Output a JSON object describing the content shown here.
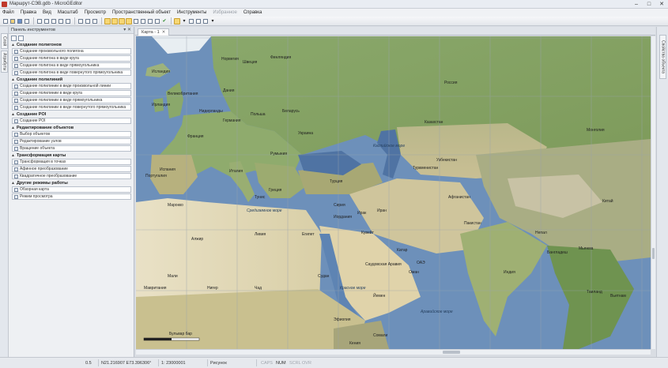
{
  "window": {
    "title": "Маршрут-СЭВ.gdb - MicroGEditor",
    "minimize": "–",
    "maximize": "□",
    "close": "✕"
  },
  "menu": {
    "items": [
      {
        "label": "Файл",
        "enabled": true
      },
      {
        "label": "Правка",
        "enabled": true
      },
      {
        "label": "Вид",
        "enabled": true
      },
      {
        "label": "Масштаб",
        "enabled": true
      },
      {
        "label": "Просмотр",
        "enabled": true
      },
      {
        "label": "Пространственный объект",
        "enabled": true
      },
      {
        "label": "Инструменты",
        "enabled": true
      },
      {
        "label": "Избранное",
        "enabled": false
      },
      {
        "label": "Справка",
        "enabled": true
      }
    ]
  },
  "left_dock": {
    "tabs": [
      "Слой",
      "Атрибуты"
    ]
  },
  "tools_panel": {
    "title": "Панель инструментов",
    "controls": "▾ ✕",
    "groups": [
      {
        "title": "Создание полигонов",
        "items": [
          "Создание произвольного полигона",
          "Создание полигона в виде круга",
          "Создание полигона в виде прямоугольника",
          "Создание полигона в виде повернутого прямоугольника"
        ]
      },
      {
        "title": "Создание полилиний",
        "items": [
          "Создание полилинии в виде произвольной линии",
          "Создание полилинии в виде круга",
          "Создание полилинии в виде прямоугольника",
          "Создание полилинии в виде повернутого прямоугольника"
        ]
      },
      {
        "title": "Создание POI",
        "items": [
          "Создание POI"
        ]
      },
      {
        "title": "Редактирование объектов",
        "items": [
          "Выбор объектов",
          "Редактирование узлов",
          "Вращение объекта"
        ]
      },
      {
        "title": "Трансформация карты",
        "items": [
          "Трансформация в точках",
          "Афинное преобразование",
          "Квадратичное преобразование"
        ]
      },
      {
        "title": "Другие режимы работы",
        "items": [
          "Обзорная карта",
          "Режим просмотра"
        ]
      }
    ]
  },
  "document_tab": {
    "label": "Карта - 1",
    "close": "✕"
  },
  "right_dock": {
    "tab": "Свойства объекта"
  },
  "map": {
    "scale_bar_label": "Бульвар бар",
    "sea_labels": [
      "Средиземное море",
      "Красное море",
      "Каспийское море",
      "Аравийское море"
    ],
    "labels": [
      "Исландия",
      "Норвегия",
      "Швеция",
      "Финляндия",
      "Великобритания",
      "Ирландия",
      "Дания",
      "Нидерланды",
      "Германия",
      "Польша",
      "Беларусь",
      "Украина",
      "Россия",
      "Франция",
      "Испания",
      "Португалия",
      "Италия",
      "Румыния",
      "Турция",
      "Греция",
      "Казахстан",
      "Узбекистан",
      "Туркменистан",
      "Сирия",
      "Ирак",
      "Иран",
      "Египет",
      "Ливия",
      "Алжир",
      "Саудовская Аравия",
      "Судан",
      "Чад",
      "Нигер",
      "Мали",
      "Мавритания",
      "Эфиопия",
      "Йемен",
      "Оман",
      "Афганистан",
      "Пакистан",
      "Индия",
      "Китай",
      "Монголия",
      "Непал",
      "Мьянма",
      "Таиланд",
      "Вьетнам",
      "Кения",
      "Сомали",
      "Тунис",
      "Марокко",
      "Иордания",
      "Кувейт",
      "Катар",
      "ОАЭ",
      "Бангладеш"
    ]
  },
  "status": {
    "zoom": "0.5",
    "coordinates": "N21.216907 E73.396306°",
    "scale": "1: 23000001",
    "mode": "Рисунок",
    "caps": "CAPS",
    "num": "NUM",
    "scrl": "SCRL",
    "ovr": "OVR"
  },
  "colors": {
    "water": "#6d90ba",
    "land_green": "#7f9e5e",
    "desert": "#e5ddc3",
    "tool_highlight": "#f7d774"
  }
}
